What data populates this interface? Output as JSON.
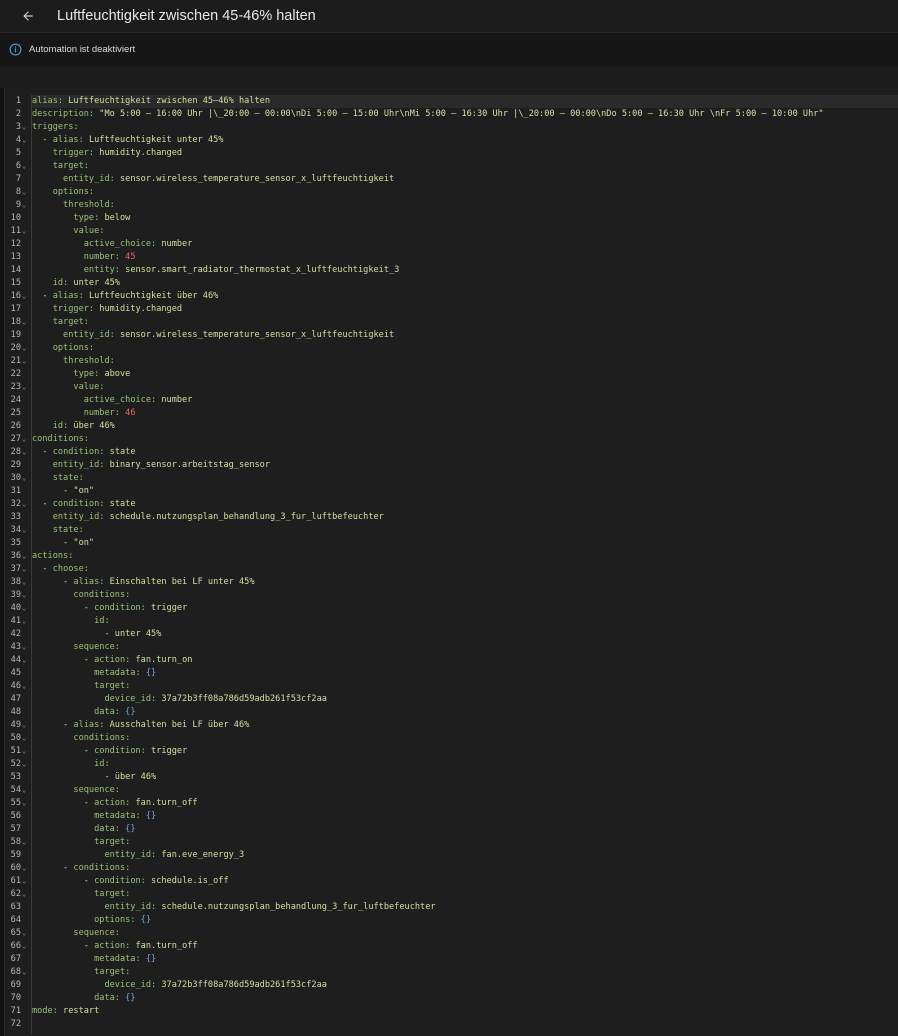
{
  "header": {
    "title": "Luftfeuchtigkeit zwischen 45-46% halten"
  },
  "notice": {
    "text": "Automation ist deaktiviert"
  },
  "editor": {
    "lines": [
      {
        "n": "1",
        "fold": false,
        "indent": 0,
        "parts": [
          [
            "k",
            "alias:"
          ],
          [
            "t",
            " Luftfeuchtigkeit zwischen 45–46% halten"
          ]
        ]
      },
      {
        "n": "2",
        "fold": false,
        "indent": 0,
        "parts": [
          [
            "k",
            "description:"
          ],
          [
            "s",
            " \"Mo 5:00 – 16:00 Uhr |\\_20:00 – 00:00\\nDi 5:00 – 15:00 Uhr\\nMi 5:00 – 16:30 Uhr |\\_20:00 – 00:00\\nDo 5:00 – 16:30 Uhr \\nFr 5:00 – 10:00 Uhr\""
          ]
        ]
      },
      {
        "n": "3",
        "fold": true,
        "indent": 0,
        "parts": [
          [
            "k",
            "triggers:"
          ]
        ]
      },
      {
        "n": "4",
        "fold": true,
        "indent": 2,
        "parts": [
          [
            "t",
            "- "
          ],
          [
            "k",
            "alias:"
          ],
          [
            "t",
            " Luftfeuchtigkeit unter 45%"
          ]
        ]
      },
      {
        "n": "5",
        "fold": false,
        "indent": 4,
        "parts": [
          [
            "k",
            "trigger:"
          ],
          [
            "t",
            " humidity.changed"
          ]
        ]
      },
      {
        "n": "6",
        "fold": true,
        "indent": 4,
        "parts": [
          [
            "k",
            "target:"
          ]
        ]
      },
      {
        "n": "7",
        "fold": false,
        "indent": 6,
        "parts": [
          [
            "k",
            "entity_id:"
          ],
          [
            "t",
            " sensor.wireless_temperature_sensor_x_luftfeuchtigkeit"
          ]
        ]
      },
      {
        "n": "8",
        "fold": true,
        "indent": 4,
        "parts": [
          [
            "k",
            "options:"
          ]
        ]
      },
      {
        "n": "9",
        "fold": true,
        "indent": 6,
        "parts": [
          [
            "k",
            "threshold:"
          ]
        ]
      },
      {
        "n": "10",
        "fold": false,
        "indent": 8,
        "parts": [
          [
            "k",
            "type:"
          ],
          [
            "t",
            " below"
          ]
        ]
      },
      {
        "n": "11",
        "fold": true,
        "indent": 8,
        "parts": [
          [
            "k",
            "value:"
          ]
        ]
      },
      {
        "n": "12",
        "fold": false,
        "indent": 10,
        "parts": [
          [
            "k",
            "active_choice:"
          ],
          [
            "t",
            " number"
          ]
        ]
      },
      {
        "n": "13",
        "fold": false,
        "indent": 10,
        "parts": [
          [
            "k",
            "number:"
          ],
          [
            "n",
            " 45"
          ]
        ]
      },
      {
        "n": "14",
        "fold": false,
        "indent": 10,
        "parts": [
          [
            "k",
            "entity:"
          ],
          [
            "t",
            " sensor.smart_radiator_thermostat_x_luftfeuchtigkeit_3"
          ]
        ]
      },
      {
        "n": "15",
        "fold": false,
        "indent": 4,
        "parts": [
          [
            "k",
            "id:"
          ],
          [
            "t",
            " unter 45%"
          ]
        ]
      },
      {
        "n": "16",
        "fold": true,
        "indent": 2,
        "parts": [
          [
            "t",
            "- "
          ],
          [
            "k",
            "alias:"
          ],
          [
            "t",
            " Luftfeuchtigkeit über 46%"
          ]
        ]
      },
      {
        "n": "17",
        "fold": false,
        "indent": 4,
        "parts": [
          [
            "k",
            "trigger:"
          ],
          [
            "t",
            " humidity.changed"
          ]
        ]
      },
      {
        "n": "18",
        "fold": true,
        "indent": 4,
        "parts": [
          [
            "k",
            "target:"
          ]
        ]
      },
      {
        "n": "19",
        "fold": false,
        "indent": 6,
        "parts": [
          [
            "k",
            "entity_id:"
          ],
          [
            "t",
            " sensor.wireless_temperature_sensor_x_luftfeuchtigkeit"
          ]
        ]
      },
      {
        "n": "20",
        "fold": true,
        "indent": 4,
        "parts": [
          [
            "k",
            "options:"
          ]
        ]
      },
      {
        "n": "21",
        "fold": true,
        "indent": 6,
        "parts": [
          [
            "k",
            "threshold:"
          ]
        ]
      },
      {
        "n": "22",
        "fold": false,
        "indent": 8,
        "parts": [
          [
            "k",
            "type:"
          ],
          [
            "t",
            " above"
          ]
        ]
      },
      {
        "n": "23",
        "fold": true,
        "indent": 8,
        "parts": [
          [
            "k",
            "value:"
          ]
        ]
      },
      {
        "n": "24",
        "fold": false,
        "indent": 10,
        "parts": [
          [
            "k",
            "active_choice:"
          ],
          [
            "t",
            " number"
          ]
        ]
      },
      {
        "n": "25",
        "fold": false,
        "indent": 10,
        "parts": [
          [
            "k",
            "number:"
          ],
          [
            "n",
            " 46"
          ]
        ]
      },
      {
        "n": "26",
        "fold": false,
        "indent": 4,
        "parts": [
          [
            "k",
            "id:"
          ],
          [
            "t",
            " über 46%"
          ]
        ]
      },
      {
        "n": "27",
        "fold": true,
        "indent": 0,
        "parts": [
          [
            "k",
            "conditions:"
          ]
        ]
      },
      {
        "n": "28",
        "fold": true,
        "indent": 2,
        "parts": [
          [
            "t",
            "- "
          ],
          [
            "k",
            "condition:"
          ],
          [
            "t",
            " state"
          ]
        ]
      },
      {
        "n": "29",
        "fold": false,
        "indent": 4,
        "parts": [
          [
            "k",
            "entity_id:"
          ],
          [
            "t",
            " binary_sensor.arbeitstag_sensor"
          ]
        ]
      },
      {
        "n": "30",
        "fold": true,
        "indent": 4,
        "parts": [
          [
            "k",
            "state:"
          ]
        ]
      },
      {
        "n": "31",
        "fold": false,
        "indent": 6,
        "parts": [
          [
            "t",
            "- "
          ],
          [
            "s",
            "\"on\""
          ]
        ]
      },
      {
        "n": "32",
        "fold": true,
        "indent": 2,
        "parts": [
          [
            "t",
            "- "
          ],
          [
            "k",
            "condition:"
          ],
          [
            "t",
            " state"
          ]
        ]
      },
      {
        "n": "33",
        "fold": false,
        "indent": 4,
        "parts": [
          [
            "k",
            "entity_id:"
          ],
          [
            "t",
            " schedule.nutzungsplan_behandlung_3_fur_luftbefeuchter"
          ]
        ]
      },
      {
        "n": "34",
        "fold": true,
        "indent": 4,
        "parts": [
          [
            "k",
            "state:"
          ]
        ]
      },
      {
        "n": "35",
        "fold": false,
        "indent": 6,
        "parts": [
          [
            "t",
            "- "
          ],
          [
            "s",
            "\"on\""
          ]
        ]
      },
      {
        "n": "36",
        "fold": true,
        "indent": 0,
        "parts": [
          [
            "k",
            "actions:"
          ]
        ]
      },
      {
        "n": "37",
        "fold": true,
        "indent": 2,
        "parts": [
          [
            "t",
            "- "
          ],
          [
            "k",
            "choose:"
          ]
        ]
      },
      {
        "n": "38",
        "fold": true,
        "indent": 6,
        "parts": [
          [
            "t",
            "- "
          ],
          [
            "k",
            "alias:"
          ],
          [
            "t",
            " Einschalten bei LF unter 45%"
          ]
        ]
      },
      {
        "n": "39",
        "fold": true,
        "indent": 8,
        "parts": [
          [
            "k",
            "conditions:"
          ]
        ]
      },
      {
        "n": "40",
        "fold": true,
        "indent": 10,
        "parts": [
          [
            "t",
            "- "
          ],
          [
            "k",
            "condition:"
          ],
          [
            "t",
            " trigger"
          ]
        ]
      },
      {
        "n": "41",
        "fold": true,
        "indent": 12,
        "parts": [
          [
            "k",
            "id:"
          ]
        ]
      },
      {
        "n": "42",
        "fold": false,
        "indent": 14,
        "parts": [
          [
            "t",
            "- unter 45%"
          ]
        ]
      },
      {
        "n": "43",
        "fold": true,
        "indent": 8,
        "parts": [
          [
            "k",
            "sequence:"
          ]
        ]
      },
      {
        "n": "44",
        "fold": true,
        "indent": 10,
        "parts": [
          [
            "t",
            "- "
          ],
          [
            "k",
            "action:"
          ],
          [
            "t",
            " fan.turn_on"
          ]
        ]
      },
      {
        "n": "45",
        "fold": false,
        "indent": 12,
        "parts": [
          [
            "k",
            "metadata:"
          ],
          [
            "b",
            " {}"
          ]
        ]
      },
      {
        "n": "46",
        "fold": true,
        "indent": 12,
        "parts": [
          [
            "k",
            "target:"
          ]
        ]
      },
      {
        "n": "47",
        "fold": false,
        "indent": 14,
        "parts": [
          [
            "k",
            "device_id:"
          ],
          [
            "t",
            " 37a72b3ff08a786d59adb261f53cf2aa"
          ]
        ]
      },
      {
        "n": "48",
        "fold": false,
        "indent": 12,
        "parts": [
          [
            "k",
            "data:"
          ],
          [
            "b",
            " {}"
          ]
        ]
      },
      {
        "n": "49",
        "fold": true,
        "indent": 6,
        "parts": [
          [
            "t",
            "- "
          ],
          [
            "k",
            "alias:"
          ],
          [
            "t",
            " Ausschalten bei LF über 46%"
          ]
        ]
      },
      {
        "n": "50",
        "fold": true,
        "indent": 8,
        "parts": [
          [
            "k",
            "conditions:"
          ]
        ]
      },
      {
        "n": "51",
        "fold": true,
        "indent": 10,
        "parts": [
          [
            "t",
            "- "
          ],
          [
            "k",
            "condition:"
          ],
          [
            "t",
            " trigger"
          ]
        ]
      },
      {
        "n": "52",
        "fold": true,
        "indent": 12,
        "parts": [
          [
            "k",
            "id:"
          ]
        ]
      },
      {
        "n": "53",
        "fold": false,
        "indent": 14,
        "parts": [
          [
            "t",
            "- über 46%"
          ]
        ]
      },
      {
        "n": "54",
        "fold": true,
        "indent": 8,
        "parts": [
          [
            "k",
            "sequence:"
          ]
        ]
      },
      {
        "n": "55",
        "fold": true,
        "indent": 10,
        "parts": [
          [
            "t",
            "- "
          ],
          [
            "k",
            "action:"
          ],
          [
            "t",
            " fan.turn_off"
          ]
        ]
      },
      {
        "n": "56",
        "fold": false,
        "indent": 12,
        "parts": [
          [
            "k",
            "metadata:"
          ],
          [
            "b",
            " {}"
          ]
        ]
      },
      {
        "n": "57",
        "fold": false,
        "indent": 12,
        "parts": [
          [
            "k",
            "data:"
          ],
          [
            "b",
            " {}"
          ]
        ]
      },
      {
        "n": "58",
        "fold": true,
        "indent": 12,
        "parts": [
          [
            "k",
            "target:"
          ]
        ]
      },
      {
        "n": "59",
        "fold": false,
        "indent": 14,
        "parts": [
          [
            "k",
            "entity_id:"
          ],
          [
            "t",
            " fan.eve_energy_3"
          ]
        ]
      },
      {
        "n": "60",
        "fold": true,
        "indent": 6,
        "parts": [
          [
            "t",
            "- "
          ],
          [
            "k",
            "conditions:"
          ]
        ]
      },
      {
        "n": "61",
        "fold": true,
        "indent": 10,
        "parts": [
          [
            "t",
            "- "
          ],
          [
            "k",
            "condition:"
          ],
          [
            "t",
            " schedule.is_off"
          ]
        ]
      },
      {
        "n": "62",
        "fold": true,
        "indent": 12,
        "parts": [
          [
            "k",
            "target:"
          ]
        ]
      },
      {
        "n": "63",
        "fold": false,
        "indent": 14,
        "parts": [
          [
            "k",
            "entity_id:"
          ],
          [
            "t",
            " schedule.nutzungsplan_behandlung_3_fur_luftbefeuchter"
          ]
        ]
      },
      {
        "n": "64",
        "fold": false,
        "indent": 12,
        "parts": [
          [
            "k",
            "options:"
          ],
          [
            "b",
            " {}"
          ]
        ]
      },
      {
        "n": "65",
        "fold": true,
        "indent": 8,
        "parts": [
          [
            "k",
            "sequence:"
          ]
        ]
      },
      {
        "n": "66",
        "fold": true,
        "indent": 10,
        "parts": [
          [
            "t",
            "- "
          ],
          [
            "k",
            "action:"
          ],
          [
            "t",
            " fan.turn_off"
          ]
        ]
      },
      {
        "n": "67",
        "fold": false,
        "indent": 12,
        "parts": [
          [
            "k",
            "metadata:"
          ],
          [
            "b",
            " {}"
          ]
        ]
      },
      {
        "n": "68",
        "fold": true,
        "indent": 12,
        "parts": [
          [
            "k",
            "target:"
          ]
        ]
      },
      {
        "n": "69",
        "fold": false,
        "indent": 14,
        "parts": [
          [
            "k",
            "device_id:"
          ],
          [
            "t",
            " 37a72b3ff08a786d59adb261f53cf2aa"
          ]
        ]
      },
      {
        "n": "70",
        "fold": false,
        "indent": 12,
        "parts": [
          [
            "k",
            "data:"
          ],
          [
            "b",
            " {}"
          ]
        ]
      },
      {
        "n": "71",
        "fold": false,
        "indent": 0,
        "parts": [
          [
            "k",
            "mode:"
          ],
          [
            "t",
            " restart"
          ]
        ]
      },
      {
        "n": "72",
        "fold": false,
        "indent": 0,
        "parts": []
      }
    ]
  }
}
